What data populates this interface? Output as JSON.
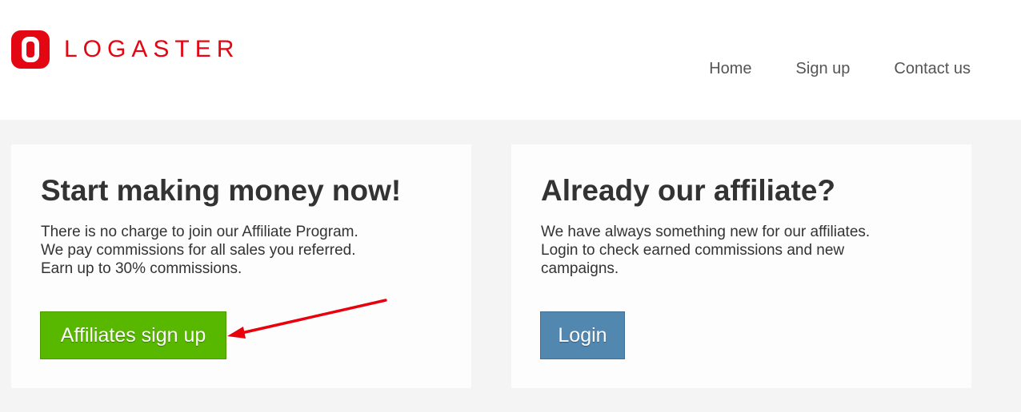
{
  "header": {
    "logo_text": "LOGASTER",
    "nav": {
      "home": "Home",
      "signup": "Sign up",
      "contact": "Contact us"
    }
  },
  "cards": {
    "left": {
      "title": "Start making money now!",
      "lines": [
        "There is no charge to join our Affiliate Program.",
        "We pay commissions for all sales you referred.",
        "Earn up to 30% commissions."
      ],
      "button": "Affiliates sign up"
    },
    "right": {
      "title": "Already our affiliate?",
      "lines": [
        "We have always something new for our affiliates.",
        "Login to check earned commissions and new",
        "campaigns."
      ],
      "button": "Login"
    }
  },
  "colors": {
    "brand_red": "#e30613",
    "signup_green": "#58b800",
    "login_blue": "#5287b0",
    "annotation_arrow": "#e8000d"
  },
  "icons": {
    "logo": "logaster-logo-icon",
    "annotation": "red-arrow-icon"
  }
}
